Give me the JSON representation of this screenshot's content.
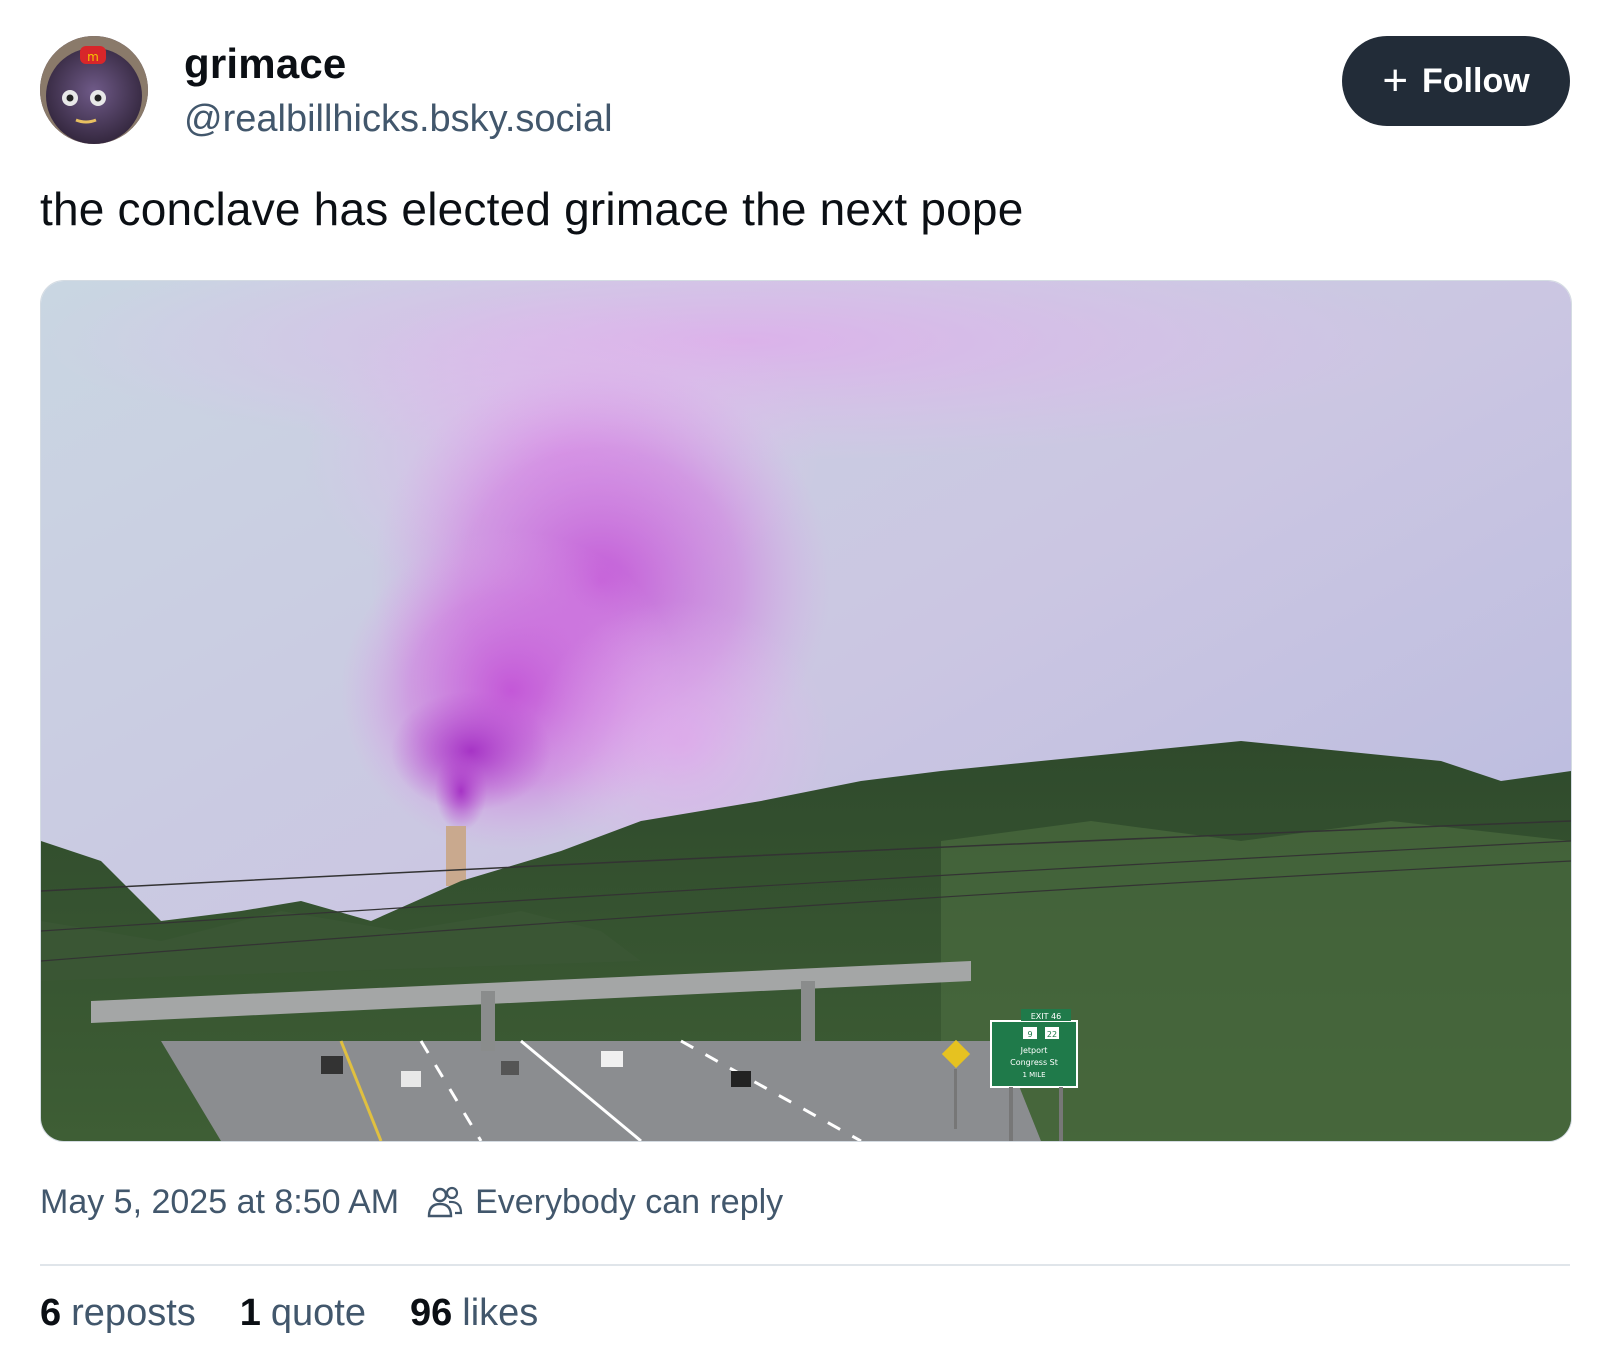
{
  "author": {
    "display_name": "grimace",
    "handle": "@realbillhicks.bsky.social",
    "avatar_icon": "grimace-avatar"
  },
  "follow_button": {
    "icon": "plus-icon",
    "label": "Follow",
    "background": "#222c38"
  },
  "post": {
    "text": "the conclave has elected grimace the next pope",
    "image": {
      "description_icon": "purple-smoke-highway-photo",
      "sign_text": {
        "exit": "EXIT 46",
        "route_a": "9",
        "route_b": "22",
        "line1": "Jetport",
        "line2": "Congress St",
        "line3": "1 MILE"
      }
    }
  },
  "meta": {
    "timestamp": "May 5, 2025 at 8:50 AM",
    "reply_icon": "people-icon",
    "reply_setting": "Everybody can reply"
  },
  "stats": {
    "reposts_count": "6",
    "reposts_label": "reposts",
    "quotes_count": "1",
    "quotes_label": "quote",
    "likes_count": "96",
    "likes_label": "likes"
  },
  "colors": {
    "text_primary": "#0b0f14",
    "text_secondary": "#42576c",
    "smoke": "#c24fd6"
  }
}
